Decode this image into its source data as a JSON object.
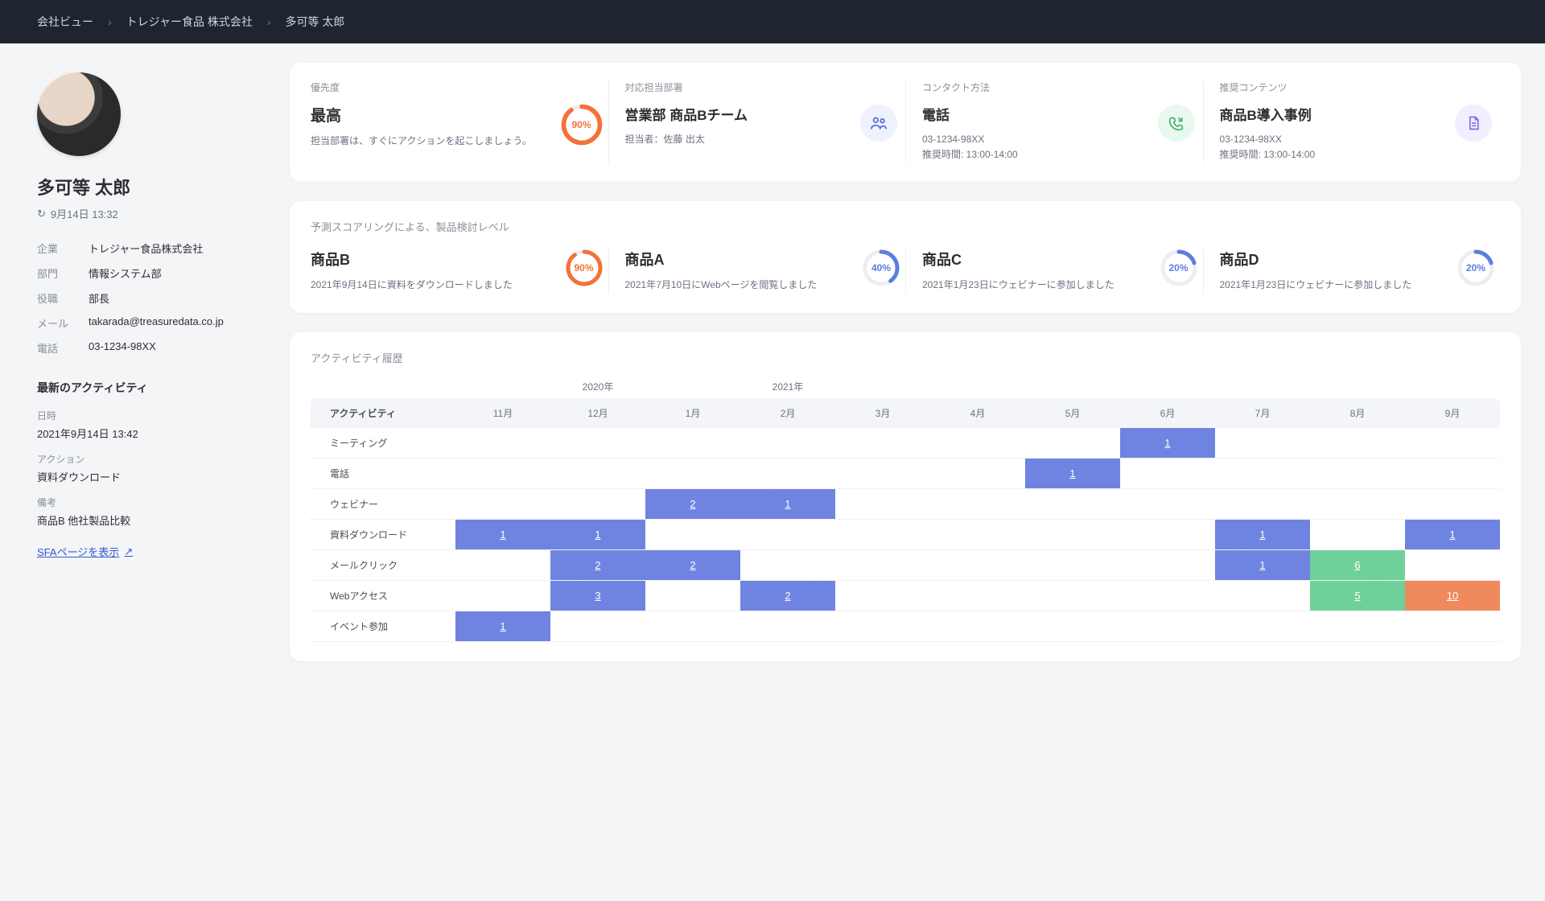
{
  "breadcrumbs": [
    "会社ビュー",
    "トレジャー食品 株式会社",
    "多可等 太郎"
  ],
  "profile": {
    "name": "多可等 太郎",
    "timestamp": "9月14日 13:32",
    "meta": {
      "company_k": "企業",
      "company_v": "トレジャー食品株式会社",
      "dept_k": "部門",
      "dept_v": "情報システム部",
      "role_k": "役職",
      "role_v": "部長",
      "mail_k": "メール",
      "mail_v": "takarada@treasuredata.co.jp",
      "tel_k": "電話",
      "tel_v": "03-1234-98XX"
    }
  },
  "activity": {
    "title": "最新のアクティビティ",
    "time_k": "日時",
    "time_v": "2021年9月14日 13:42",
    "action_k": "アクション",
    "action_v": "資料ダウンロード",
    "note_k": "備考",
    "note_v": "商品B 他社製品比較",
    "sfa_link": "SFAページを表示"
  },
  "summary": {
    "priority": {
      "label": "優先度",
      "value": "最高",
      "desc": "担当部署は、すぐにアクションを起こしましょう。",
      "pct": "90%",
      "pct_n": 90,
      "color": "#f4713a"
    },
    "dept": {
      "label": "対応担当部署",
      "value": "営業部 商品Bチーム",
      "desc": "担当者：佐藤 出太"
    },
    "contact": {
      "label": "コンタクト方法",
      "value": "電話",
      "desc1": "03-1234-98XX",
      "desc2": "推奨時間: 13:00-14:00"
    },
    "content": {
      "label": "推奨コンテンツ",
      "value": "商品B導入事例",
      "desc1": "03-1234-98XX",
      "desc2": "推奨時間: 13:00-14:00"
    }
  },
  "scoring": {
    "title": "予測スコアリングによる、製品検討レベル",
    "products": [
      {
        "name": "商品B",
        "desc": "2021年9月14日に資料をダウンロードしました",
        "pct": "90%",
        "pct_n": 90,
        "color": "#f4713a"
      },
      {
        "name": "商品A",
        "desc": "2021年7月10日にWebページを閲覧しました",
        "pct": "40%",
        "pct_n": 40,
        "color": "#5b7fe0"
      },
      {
        "name": "商品C",
        "desc": "2021年1月23日にウェビナーに参加しました",
        "pct": "20%",
        "pct_n": 20,
        "color": "#5b7fe0"
      },
      {
        "name": "商品D",
        "desc": "2021年1月23日にウェビナーに参加しました",
        "pct": "20%",
        "pct_n": 20,
        "color": "#5b7fe0"
      }
    ]
  },
  "history": {
    "title": "アクティビティ履歴",
    "year1": "2020年",
    "year2": "2021年",
    "col_label": "アクティビティ",
    "months": [
      "11月",
      "12月",
      "1月",
      "2月",
      "3月",
      "4月",
      "5月",
      "6月",
      "7月",
      "8月",
      "9月"
    ],
    "rows": [
      {
        "label": "ミーティング",
        "cells": [
          null,
          null,
          null,
          null,
          null,
          null,
          null,
          {
            "v": "1",
            "c": "b-blue"
          },
          null,
          null,
          null
        ]
      },
      {
        "label": "電話",
        "cells": [
          null,
          null,
          null,
          null,
          null,
          null,
          {
            "v": "1",
            "c": "b-blue"
          },
          null,
          null,
          null,
          null
        ]
      },
      {
        "label": "ウェビナー",
        "cells": [
          null,
          null,
          {
            "v": "2",
            "c": "b-blue"
          },
          {
            "v": "1",
            "c": "b-blue"
          },
          null,
          null,
          null,
          null,
          null,
          null,
          null
        ]
      },
      {
        "label": "資料ダウンロード",
        "cells": [
          {
            "v": "1",
            "c": "b-blue"
          },
          {
            "v": "1",
            "c": "b-blue"
          },
          null,
          null,
          null,
          null,
          null,
          null,
          {
            "v": "1",
            "c": "b-blue"
          },
          null,
          {
            "v": "1",
            "c": "b-blue"
          }
        ]
      },
      {
        "label": "メールクリック",
        "cells": [
          null,
          {
            "v": "2",
            "c": "b-blue"
          },
          {
            "v": "2",
            "c": "b-blue"
          },
          null,
          null,
          null,
          null,
          null,
          {
            "v": "1",
            "c": "b-blue"
          },
          {
            "v": "6",
            "c": "b-green"
          },
          null
        ]
      },
      {
        "label": "Webアクセス",
        "cells": [
          null,
          {
            "v": "3",
            "c": "b-blue"
          },
          null,
          {
            "v": "2",
            "c": "b-blue"
          },
          null,
          null,
          null,
          null,
          null,
          {
            "v": "5",
            "c": "b-green"
          },
          {
            "v": "10",
            "c": "b-orange"
          }
        ]
      },
      {
        "label": "イベント参加",
        "cells": [
          {
            "v": "1",
            "c": "b-blue"
          },
          null,
          null,
          null,
          null,
          null,
          null,
          null,
          null,
          null,
          null
        ]
      }
    ]
  }
}
